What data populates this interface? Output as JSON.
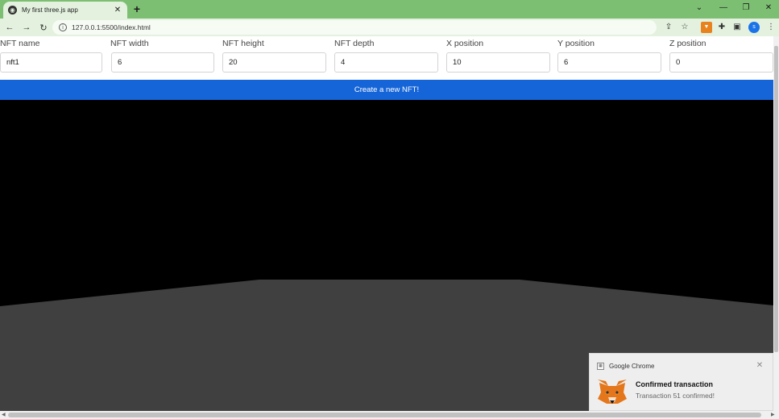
{
  "browser": {
    "tab_title": "My first three.js app",
    "tab_close": "✕",
    "new_tab": "+",
    "url": "127.0.0.1:5500/index.html",
    "nav": {
      "back": "←",
      "forward": "→",
      "reload": "↻"
    },
    "window_controls": {
      "dropdown": "⌄",
      "minimize": "—",
      "restore": "❐",
      "close": "✕"
    },
    "toolbar_icons": [
      "share-icon",
      "star-icon",
      "metamask-extension-icon",
      "puzzle-icon",
      "sidepanel-icon",
      "profile-avatar",
      "menu-kebab-icon"
    ],
    "avatar_letter": "s",
    "menu": "⋮"
  },
  "form": {
    "fields": [
      {
        "label": "NFT name",
        "value": "nft1"
      },
      {
        "label": "NFT width",
        "value": "6"
      },
      {
        "label": "NFT height",
        "value": "20"
      },
      {
        "label": "NFT depth",
        "value": "4"
      },
      {
        "label": "X position",
        "value": "10"
      },
      {
        "label": "Y position",
        "value": "6"
      },
      {
        "label": "Z position",
        "value": "0"
      }
    ],
    "create_button": "Create a new NFT!"
  },
  "scene": {
    "background": "#000000",
    "ground_color": "#404040"
  },
  "notification": {
    "app": "Google Chrome",
    "title": "Confirmed transaction",
    "message": "Transaction 51 confirmed!",
    "close": "✕"
  },
  "colors": {
    "tabstrip": "#7cbf72",
    "toolbar": "#e3f1de",
    "create_button": "#1565d8",
    "metamask_orange": "#e8821e"
  }
}
